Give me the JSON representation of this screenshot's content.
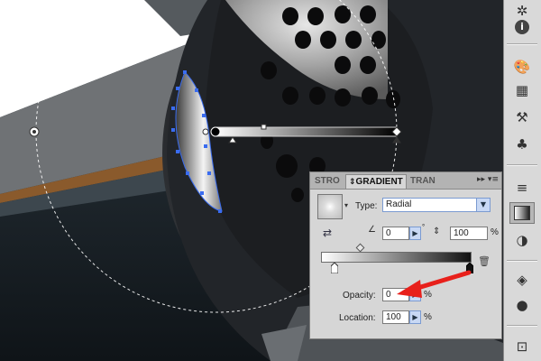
{
  "panel": {
    "tabs": [
      "STRO",
      "GRADIENT",
      "TRAN"
    ],
    "active_tab": "GRADIENT",
    "menu_glyph": "▸▸ ▾≡",
    "type_label": "Type:",
    "type_value": "Radial",
    "angle_value": "0",
    "angle_degree": "°",
    "aspect_value": "100",
    "aspect_unit": "%",
    "opacity_label": "Opacity:",
    "opacity_value": "0",
    "opacity_unit": "%",
    "location_label": "Location:",
    "location_value": "100",
    "location_unit": "%",
    "gradient_stops": [
      {
        "location": 0,
        "color": "#ffffff",
        "opacity": 100
      },
      {
        "location": 100,
        "color": "#111111",
        "opacity": 0
      }
    ],
    "midpoint": 28
  },
  "tools": [
    "sparkle-icon",
    "info-icon",
    "palette-icon",
    "grid-icon",
    "brush-icon",
    "club-icon",
    "stroke-icon",
    "gradient-icon",
    "transparency-icon",
    "appearance-icon",
    "graphic-styles-icon",
    "layers-icon",
    "artboard-icon"
  ],
  "colors": {
    "arrow": "#e8201b",
    "selection": "#3a6cf0",
    "panel_bg": "#d6d6d6",
    "accent": "#7b9bd1"
  }
}
